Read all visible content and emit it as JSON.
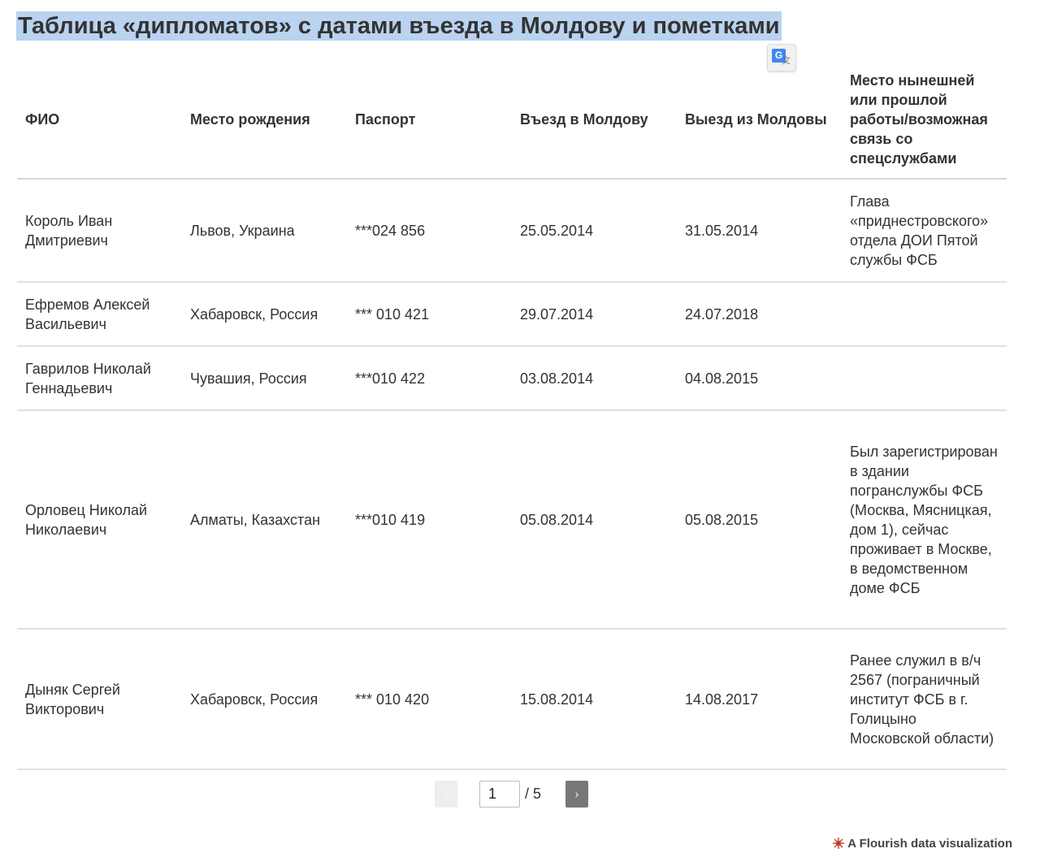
{
  "title": "Таблица «дипломатов» с датами въезда в Молдову и пометками",
  "table": {
    "headers": [
      "ФИО",
      "Место рождения",
      "Паспорт",
      "Въезд в Молдову",
      "Выезд из Молдовы",
      "Место нынешней или прошлой работы/возможная связь со спецслужбами"
    ],
    "rows": [
      [
        "Король Иван Дмитриевич",
        "Львов, Украина",
        "***024 856",
        "25.05.2014",
        "31.05.2014",
        "Глава «приднестровского» отдела ДОИ Пятой службы ФСБ"
      ],
      [
        "Ефремов Алексей Васильевич",
        "Хабаровск, Россия",
        "*** 010 421",
        "29.07.2014",
        "24.07.2018",
        ""
      ],
      [
        "Гаврилов Николай Геннадьевич",
        "Чувашия, Россия",
        "***010 422",
        "03.08.2014",
        "04.08.2015",
        ""
      ],
      [
        "Орловец Николай Николаевич",
        "Алматы, Казахстан",
        "***010 419",
        "05.08.2014",
        "05.08.2015",
        "Был зарегистрирован в здании погранслужбы ФСБ (Москва, Мясницкая, дом 1), сейчас проживает в Москве, в ведомственном доме ФСБ"
      ],
      [
        "Дыняк Сергей Викторович",
        "Хабаровск, Россия",
        "*** 010 420",
        "15.08.2014",
        "14.08.2017",
        "Ранее служил в в/ч 2567 (пограничный институт ФСБ в г. Голицыно Московской области)"
      ]
    ]
  },
  "pagination": {
    "prev_label": "‹",
    "next_label": "›",
    "current_page": "1",
    "total_label": "/ 5"
  },
  "credit": "A Flourish data visualization",
  "icons": {
    "translate": "google-translate-icon",
    "prev": "chevron-left-icon",
    "next": "chevron-right-icon",
    "credit": "flourish-logo-icon"
  },
  "colors": {
    "title_highlight": "#b9d3f0",
    "text": "#333333",
    "next_button": "#777777",
    "prev_button": "#eeeeee",
    "logo": "#c0392b"
  }
}
